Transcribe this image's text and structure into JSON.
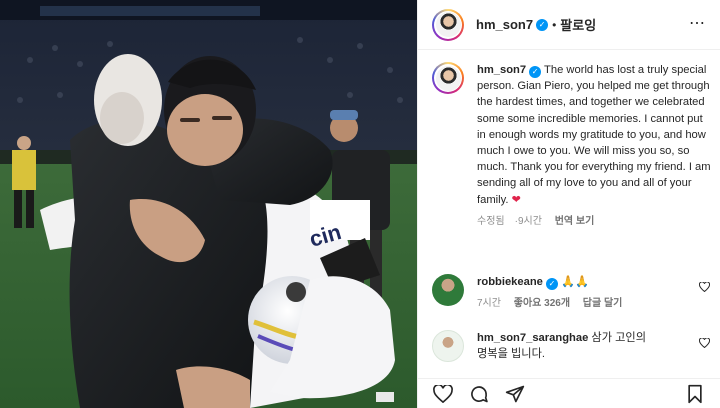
{
  "post": {
    "author": "hm_son7",
    "follow_label": "팔로잉",
    "separator": "•",
    "more_label": "⋯"
  },
  "caption": {
    "author": "hm_son7",
    "text": "The world has lost a truly special person. Gian Piero, you helped me get through the hardest times, and together we celebrated some some incredible memories. I cannot put in enough words my gratitude to you, and how much I owe to you. We will miss you so, so much. Thank you for everything my friend. I am sending all of my love to you and all of your family.",
    "emoji": "❤",
    "edited_label": "수정됨",
    "time": "9시간",
    "translate_label": "번역 보기"
  },
  "comments": [
    {
      "author": "robbiekeane",
      "text": "🙏🙏",
      "time": "7시간",
      "likes": "좋아요 326개",
      "reply_label": "답글 달기"
    },
    {
      "author": "hm_son7_saranghae",
      "text": "삼가 고인의 명복을 빕니다."
    }
  ],
  "photo": {
    "sponsor_text": "cin"
  },
  "colors": {
    "verified": "#0095f6",
    "heart": "#e0244b",
    "muted": "#8e8e8e"
  },
  "icons": [
    "verified-badge-icon",
    "more-options-icon",
    "heart-icon",
    "comment-icon",
    "share-icon",
    "bookmark-icon"
  ]
}
